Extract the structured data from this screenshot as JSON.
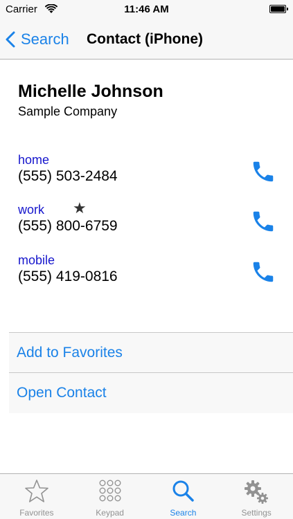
{
  "status_bar": {
    "carrier": "Carrier",
    "time": "11:46 AM",
    "wifi_icon": "wifi-icon",
    "battery_icon": "battery-icon",
    "battery_level": 1.0
  },
  "nav": {
    "back_label": "Search",
    "title": "Contact (iPhone)"
  },
  "contact": {
    "name": "Michelle Johnson",
    "company": "Sample Company"
  },
  "phones": [
    {
      "label": "home",
      "number": "(555) 503-2484",
      "favorite": false
    },
    {
      "label": "work",
      "number": "(555) 800-6759",
      "favorite": true
    },
    {
      "label": "mobile",
      "number": "(555) 419-0816",
      "favorite": false
    }
  ],
  "actions": {
    "add_favorites": "Add to Favorites",
    "open_contact": "Open Contact"
  },
  "tabs": [
    {
      "label": "Favorites",
      "icon": "star-outline-icon",
      "active": false
    },
    {
      "label": "Keypad",
      "icon": "keypad-icon",
      "active": false
    },
    {
      "label": "Search",
      "icon": "search-icon",
      "active": true
    },
    {
      "label": "Settings",
      "icon": "gear-icon",
      "active": false
    }
  ],
  "colors": {
    "accent": "#1a82e8",
    "phone_label": "#1515cc",
    "inactive_tab": "#929292"
  }
}
